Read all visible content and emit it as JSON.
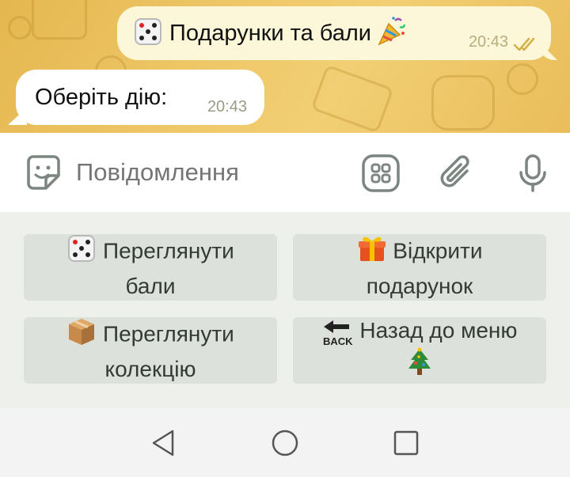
{
  "chat": {
    "outgoing": {
      "text": "Подарунки та бали",
      "time": "20:43",
      "status": "read"
    },
    "incoming": {
      "text": "Оберіть дію:",
      "time": "20:43"
    }
  },
  "composer": {
    "placeholder": "Повідомлення"
  },
  "keyboard": {
    "buttons": [
      {
        "line1": "Переглянути",
        "line2": "бали",
        "icon": "dice-icon"
      },
      {
        "line1": "Відкрити",
        "line2": "подарунок",
        "icon": "gift-icon"
      },
      {
        "line1": "Переглянути",
        "line2": "колекцію",
        "icon": "package-icon"
      },
      {
        "line1": "Назад до меню",
        "line2": "",
        "icon": "back-arrow-icon",
        "trailing_icon": "christmas-tree-icon",
        "back_label": "BACK"
      }
    ]
  },
  "colors": {
    "chat_bg": "#eec666",
    "bubble_out": "#fdf7d9",
    "button_bg": "#dde1dc",
    "icon_gray": "#7c8580"
  }
}
